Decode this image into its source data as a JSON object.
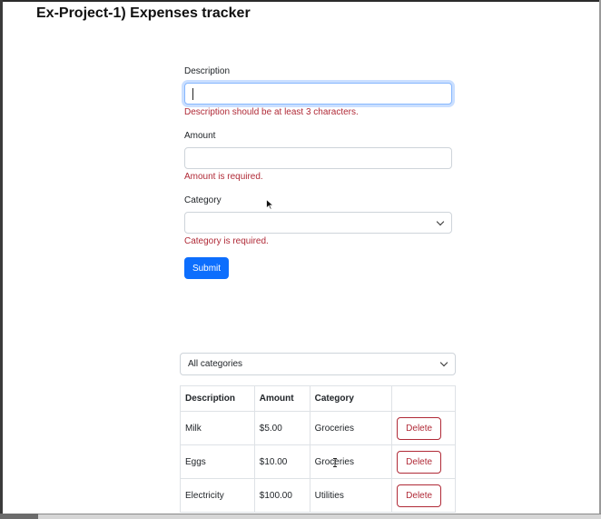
{
  "page": {
    "title": "Ex-Project-1) Expenses tracker"
  },
  "form": {
    "description": {
      "label": "Description",
      "value": "",
      "error": "Description should be at least 3 characters."
    },
    "amount": {
      "label": "Amount",
      "value": "",
      "error": "Amount is required."
    },
    "category": {
      "label": "Category",
      "selected": "",
      "error": "Category is required."
    },
    "submit_label": "Submit"
  },
  "filter": {
    "selected": "All categories"
  },
  "table": {
    "headers": [
      "Description",
      "Amount",
      "Category",
      ""
    ],
    "rows": [
      {
        "description": "Milk",
        "amount": "$5.00",
        "category": "Groceries",
        "action": "Delete"
      },
      {
        "description": "Eggs",
        "amount": "$10.00",
        "category": "Groceries",
        "action": "Delete"
      },
      {
        "description": "Electricity",
        "amount": "$100.00",
        "category": "Utilities",
        "action": "Delete"
      }
    ]
  },
  "colors": {
    "primary": "#0d6efd",
    "danger": "#b02a37",
    "border": "#ced4da",
    "focus": "#86b7fe"
  },
  "icons": {
    "select_indicator": "chevron-down-icon",
    "mouse": "mouse-pointer-icon",
    "text_cursor": "text-cursor-icon"
  }
}
